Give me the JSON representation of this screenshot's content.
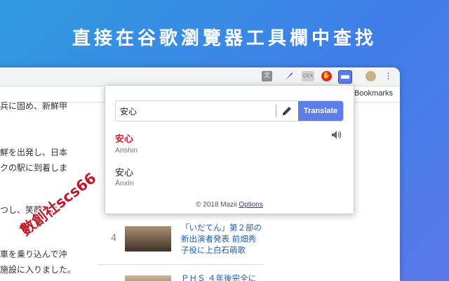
{
  "headline": "直接在谷歌瀏覽器工具欄中查找",
  "toolbar": {
    "ext_icons": [
      "translate-icon",
      "feather-icon",
      "ckx-icon",
      "stop-hand-icon",
      "mazii-icon",
      "avatar",
      "more-icon"
    ],
    "ckx_label": "CKX"
  },
  "bookmarks": {
    "other_label": "r Bookmarks"
  },
  "page": {
    "lines": [
      "兵に固め、新鮮甲",
      "鮮を出発し、日本",
      "クの駅に到着しま",
      "つし、笑顔でこ",
      "車を乗り込んで沖",
      "施設に入りました。"
    ],
    "news": {
      "number": "4",
      "title_lines": [
        "「いだてん」第２部の",
        "新出演者発表 前畑秀",
        "子役に上白石萌歌"
      ],
      "next_title": "ＰＨＳ ４年後完全に"
    }
  },
  "watermark": "數創社scs66",
  "popup": {
    "search_value": "安心",
    "translate_label": "Translate",
    "results": [
      {
        "word": "安心",
        "reading": "Anshin",
        "color": "#d0202e"
      },
      {
        "word": "安心",
        "reading": "Ānxīn",
        "color": "#222222"
      }
    ],
    "footer_copyright": "© 2018 Mazii",
    "footer_options": "Options"
  },
  "colors": {
    "accent": "#5d7ee8",
    "highlight": "#d0202e"
  }
}
